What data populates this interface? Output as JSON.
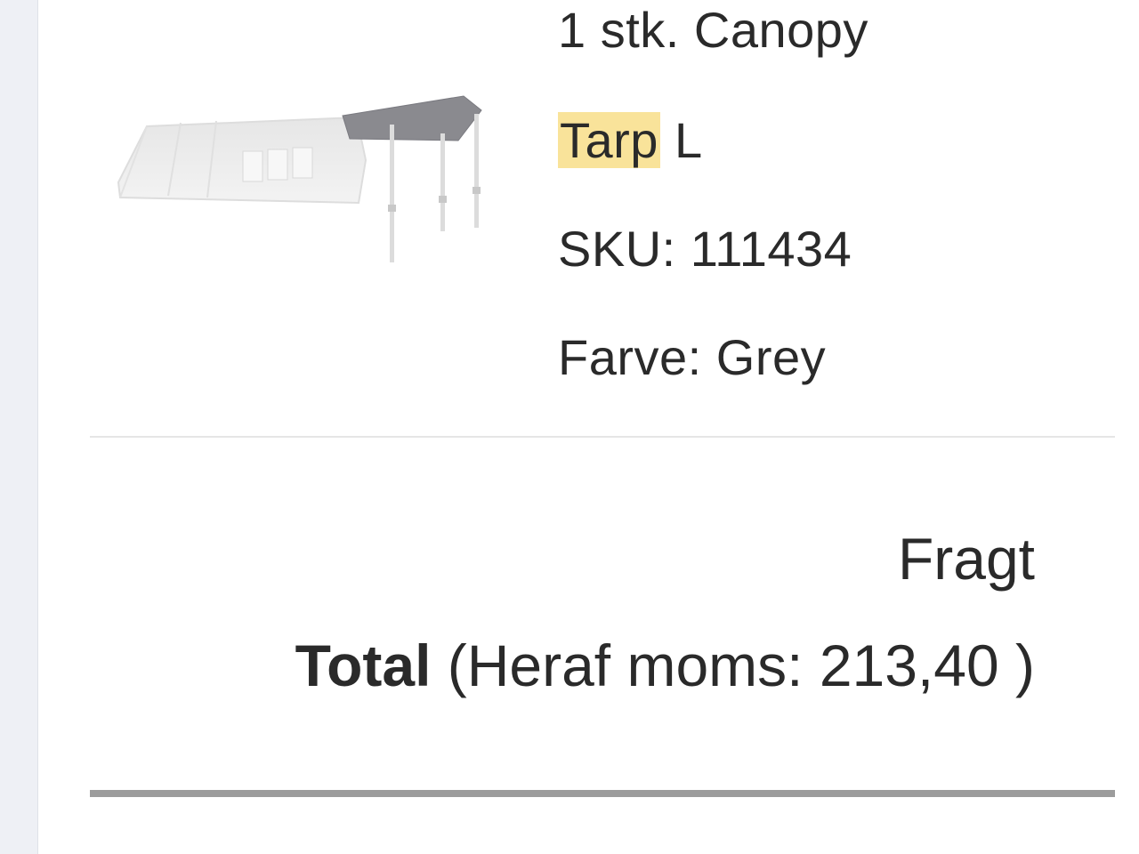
{
  "order_item": {
    "quantity_line": "1 stk. Canopy",
    "variant_highlight": "Tarp",
    "variant_rest": " L",
    "sku_line": "SKU: 111434",
    "color_line": "Farve: Grey",
    "image_name": "tent-tarp-canopy-image"
  },
  "summary": {
    "fragt_label": "Fragt",
    "total_label": "Total",
    "total_detail": " (Heraf moms: 213,40 )"
  },
  "colors": {
    "highlight": "#f9e39a",
    "text": "#2a2a2a",
    "divider": "#e6e6e6",
    "rule": "#9c9c9c"
  }
}
